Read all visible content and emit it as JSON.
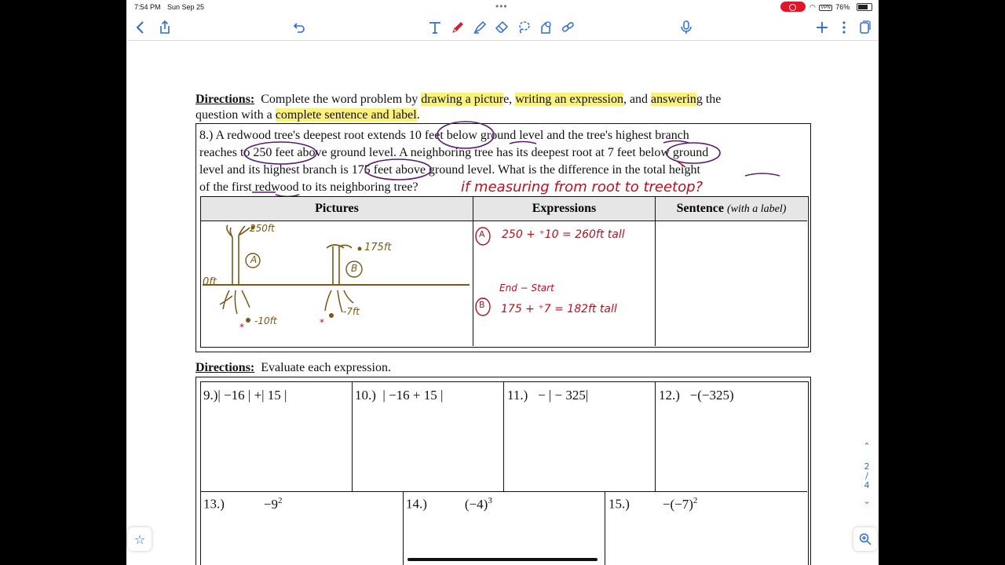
{
  "status": {
    "time": "7:54 PM",
    "date": "Sun Sep 25",
    "vpn": "VPN",
    "battery": "76%"
  },
  "toolbar": {
    "left_icons": [
      "back-icon",
      "share-icon",
      "undo-icon"
    ],
    "tools": [
      "text-tool-icon",
      "pen-tool-icon",
      "highlighter-tool-icon",
      "eraser-tool-icon",
      "lasso-tool-icon",
      "shape-tool-icon",
      "link-tool-icon"
    ],
    "right_icons": [
      "mic-icon",
      "add-icon",
      "more-icon",
      "pages-icon"
    ],
    "accent": "#2b6cd4"
  },
  "worksheet": {
    "directions1": {
      "label": "Directions:",
      "parts": [
        "Complete the word problem by ",
        "drawing a pictur",
        "e, ",
        "writing an expression",
        ", and ",
        "answerin",
        "g the"
      ],
      "line2": [
        "question with a ",
        "complete sentence and label",
        "."
      ]
    },
    "problem8": {
      "lines": [
        "8.)  A redwood tree's deepest root extends 10 feet below ground level and the tree's highest branch",
        "reaches to 250 feet above ground level.  A neighboring tree has its deepest root at 7 feet below ground",
        "level and its highest branch is 175 feet above ground level.  What is the difference in the total height",
        "of the first redwood to its neighboring tree?"
      ],
      "handwritten_note": "if measuring from root to treetop?"
    },
    "table": {
      "headers": [
        "Pictures",
        "Expressions",
        "Sentence"
      ],
      "sentence_suffix": "(with a label)",
      "picture_notes": {
        "top_a": "250ft",
        "label_a": "A",
        "ground": "0ft",
        "bottom_a": "-10ft",
        "top_b": "175ft",
        "label_b": "B",
        "bottom_b": "-7ft"
      },
      "expressions": {
        "a_label": "A",
        "a": "250 + ⁺10  =  260ft tall",
        "note": "End − Start",
        "b_label": "B",
        "b": "175 + ⁺7  =  182ft tall"
      }
    },
    "directions2": {
      "label": "Directions:",
      "text": "Evaluate each expression."
    },
    "row1": [
      {
        "num": "9.)",
        "expr": "| −16 | +| 15 |"
      },
      {
        "num": "10.)",
        "expr": "| −16 + 15 |"
      },
      {
        "num": "11.)",
        "expr": "− | − 325|"
      },
      {
        "num": "12.)",
        "expr": "−(−325)"
      }
    ],
    "row2": [
      {
        "num": "13.)",
        "base": "−9",
        "exp": "2"
      },
      {
        "num": "14.)",
        "base": "(−4)",
        "exp": "3"
      },
      {
        "num": "15.)",
        "base": "−(−7)",
        "exp": "2"
      }
    ]
  },
  "sidebar": {
    "up": "⌃",
    "page_current": "2",
    "page_sep": "/",
    "page_total": "4",
    "down": "⌄"
  },
  "colors": {
    "ink_red": "#b4121f",
    "ink_brown": "#7a5818",
    "highlight": "#fbf27b"
  }
}
